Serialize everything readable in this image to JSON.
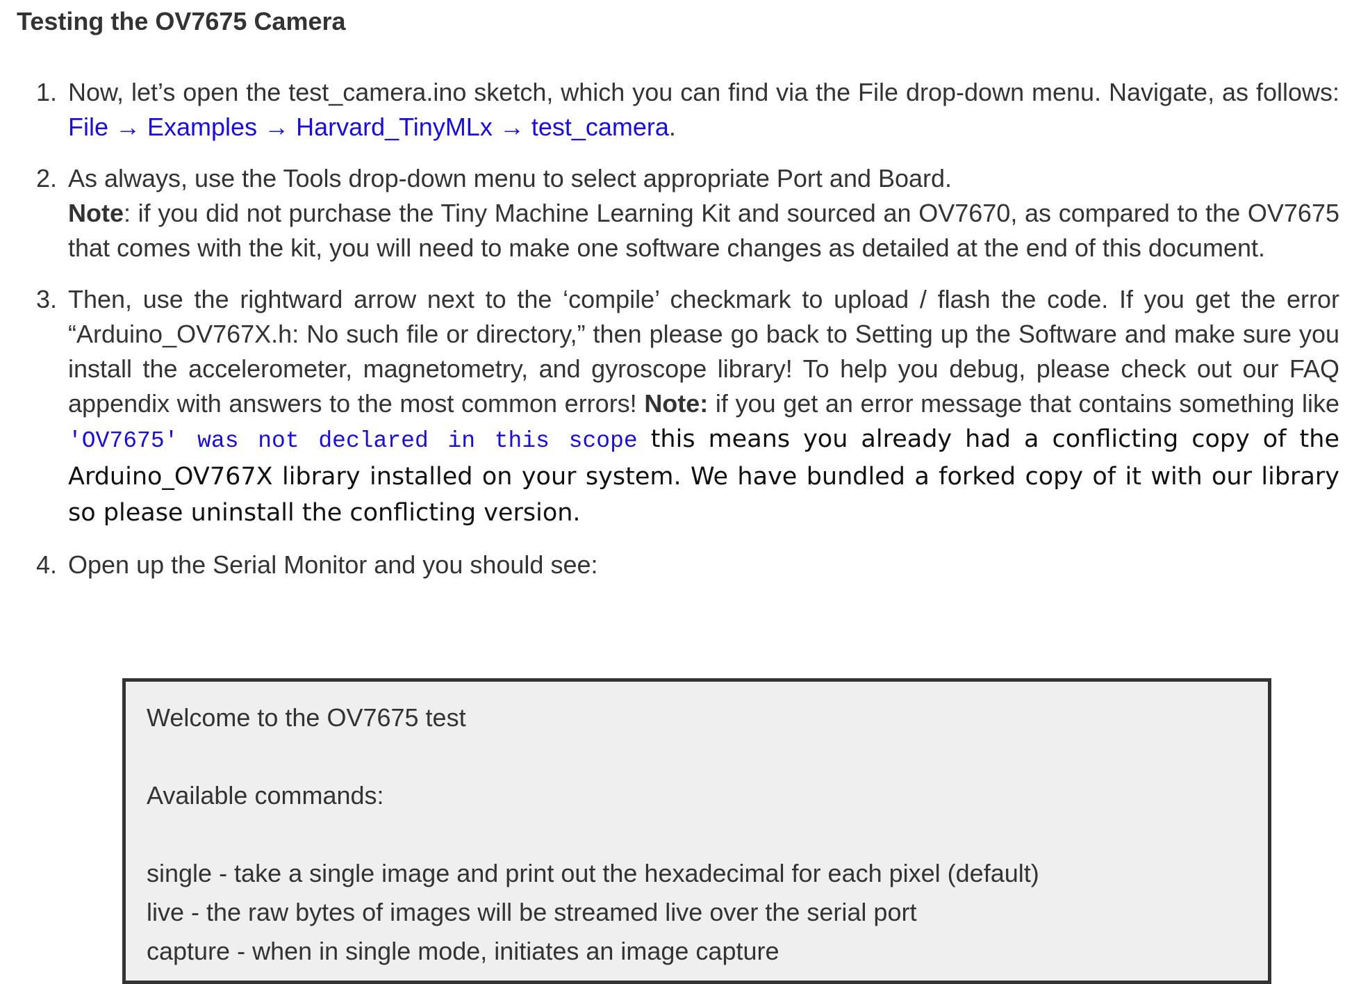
{
  "heading": "Testing the OV7675 Camera",
  "steps": [
    {
      "number": "1.",
      "text_a": "Now, let’s open the test_camera.ino sketch, which you can find via the File drop-down menu. Navigate, as follows: ",
      "link": "File → Examples → Harvard_TinyMLx → test_camera",
      "text_b": "."
    },
    {
      "number": "2.",
      "text_a": "As always, use the Tools drop-down menu to select appropriate Port and Board.",
      "note_label": "Note",
      "text_b": ": if you did not purchase the Tiny Machine Learning Kit and sourced an OV7670, as compared to the OV7675 that comes with the kit, you will need to make one software changes as detailed at the end of this document."
    },
    {
      "number": "3.",
      "text_a": "Then, use the rightward arrow next to the ‘compile’ checkmark to upload / flash the code. If you get the error “Arduino_OV767X.h: No such file or directory,” then please go back to Setting up the Software and make sure you install the accelerometer, magnetometry, and gyroscope library! To help you debug, please check out our FAQ appendix with answers to the most common errors! ",
      "note_label": "Note:",
      "text_b": " if you get an error message that contains something like ",
      "code": "'OV7675' was not declared in this scope",
      "text_c": " this means you already had a conflicting copy of the Arduino_OV767X library installed on your system. We have bundled a forked copy of it with our library so please uninstall the conflicting version."
    },
    {
      "number": "4.",
      "text_a": "Open up the Serial Monitor and you should see:"
    }
  ],
  "serial_output": {
    "lines": [
      "Welcome to the OV7675 test",
      "",
      "Available commands:",
      "",
      "single - take a single image and print out the hexadecimal for each pixel (default)",
      "live - the raw bytes of images will be streamed live over the serial port",
      "capture - when in single mode, initiates an image capture"
    ]
  },
  "colors": {
    "text": "#333333",
    "link": "#1a0dd8",
    "serial_background": "#efefef",
    "serial_border": "#333333"
  }
}
